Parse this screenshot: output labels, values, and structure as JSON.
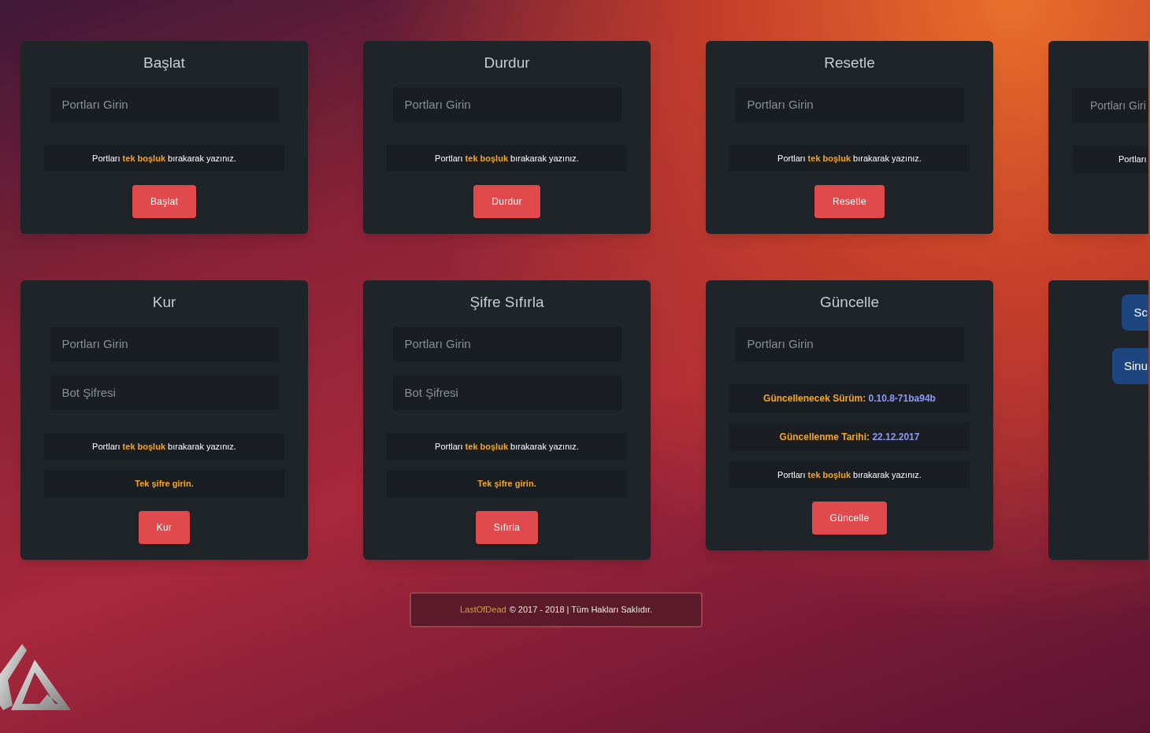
{
  "rows": [
    {
      "cards": [
        {
          "kind": "full",
          "title": "Başlat",
          "fields": [
            {
              "placeholder": "Portları Girin"
            }
          ],
          "notes": [
            {
              "kind": "hint",
              "text": "Portları **tek boşluk** bırakarak yazınız."
            }
          ],
          "buttons": [
            {
              "label": "Başlat",
              "color": "#e04a4c"
            }
          ]
        },
        {
          "kind": "full",
          "title": "Durdur",
          "fields": [
            {
              "placeholder": "Portları Girin"
            }
          ],
          "notes": [
            {
              "kind": "hint",
              "text": "Portları **tek boşluk** bırakarak yazınız."
            }
          ],
          "buttons": [
            {
              "label": "Durdur",
              "color": "#e04a4c"
            }
          ]
        },
        {
          "kind": "full",
          "title": "Resetle",
          "fields": [
            {
              "placeholder": "Portları Girin"
            }
          ],
          "notes": [
            {
              "kind": "hint",
              "text": "Portları **tek boşluk** bırakarak yazınız."
            }
          ],
          "buttons": [
            {
              "label": "Resetle",
              "color": "#e04a4c"
            }
          ]
        },
        {
          "kind": "partial",
          "fields": [
            {
              "placeholder": "Portları Giri"
            }
          ],
          "notes": [
            {
              "kind": "hint",
              "text": "Portları"
            }
          ]
        }
      ]
    },
    {
      "cards": [
        {
          "kind": "full",
          "title": "Kur",
          "fields": [
            {
              "placeholder": "Portları Girin"
            },
            {
              "placeholder": "Bot Şifresi"
            }
          ],
          "notes": [
            {
              "kind": "hint",
              "text": "Portları **tek boşluk** bırakarak yazınız."
            },
            {
              "kind": "warning",
              "text": "Tek şifre girin."
            }
          ],
          "buttons": [
            {
              "label": "Kur",
              "color": "#e04a4c"
            }
          ]
        },
        {
          "kind": "full",
          "title": "Şifre Sıfırla",
          "fields": [
            {
              "placeholder": "Portları Girin"
            },
            {
              "placeholder": "Bot Şifresi"
            }
          ],
          "notes": [
            {
              "kind": "hint",
              "text": "Portları **tek boşluk** bırakarak yazınız."
            },
            {
              "kind": "warning",
              "text": "Tek şifre girin."
            }
          ],
          "buttons": [
            {
              "label": "Sıfırla",
              "color": "#e04a4c"
            }
          ]
        },
        {
          "kind": "full",
          "title": "Güncelle",
          "fields": [
            {
              "placeholder": "Portları Girin"
            }
          ],
          "notes": [
            {
              "kind": "info",
              "label": "Güncellenecek Sürüm:",
              "value": "0.10.8-71ba94b"
            },
            {
              "kind": "info",
              "label": "Güncellenme Tarihi:",
              "value": "22.12.2017"
            },
            {
              "kind": "hint",
              "text": "Portları **tek boşluk** bırakarak yazınız."
            }
          ],
          "buttons": [
            {
              "label": "Güncelle",
              "color": "#e04a4c"
            }
          ]
        },
        {
          "kind": "partial",
          "buttons": [
            {
              "label": "Sc",
              "color": "#1d4580"
            },
            {
              "label": "Sinu",
              "color": "#1d4580"
            }
          ]
        }
      ]
    }
  ],
  "footer": {
    "brand": "LastOfDead",
    "text": "© 2017 - 2018 | Tüm Hakları Saklıdır."
  }
}
